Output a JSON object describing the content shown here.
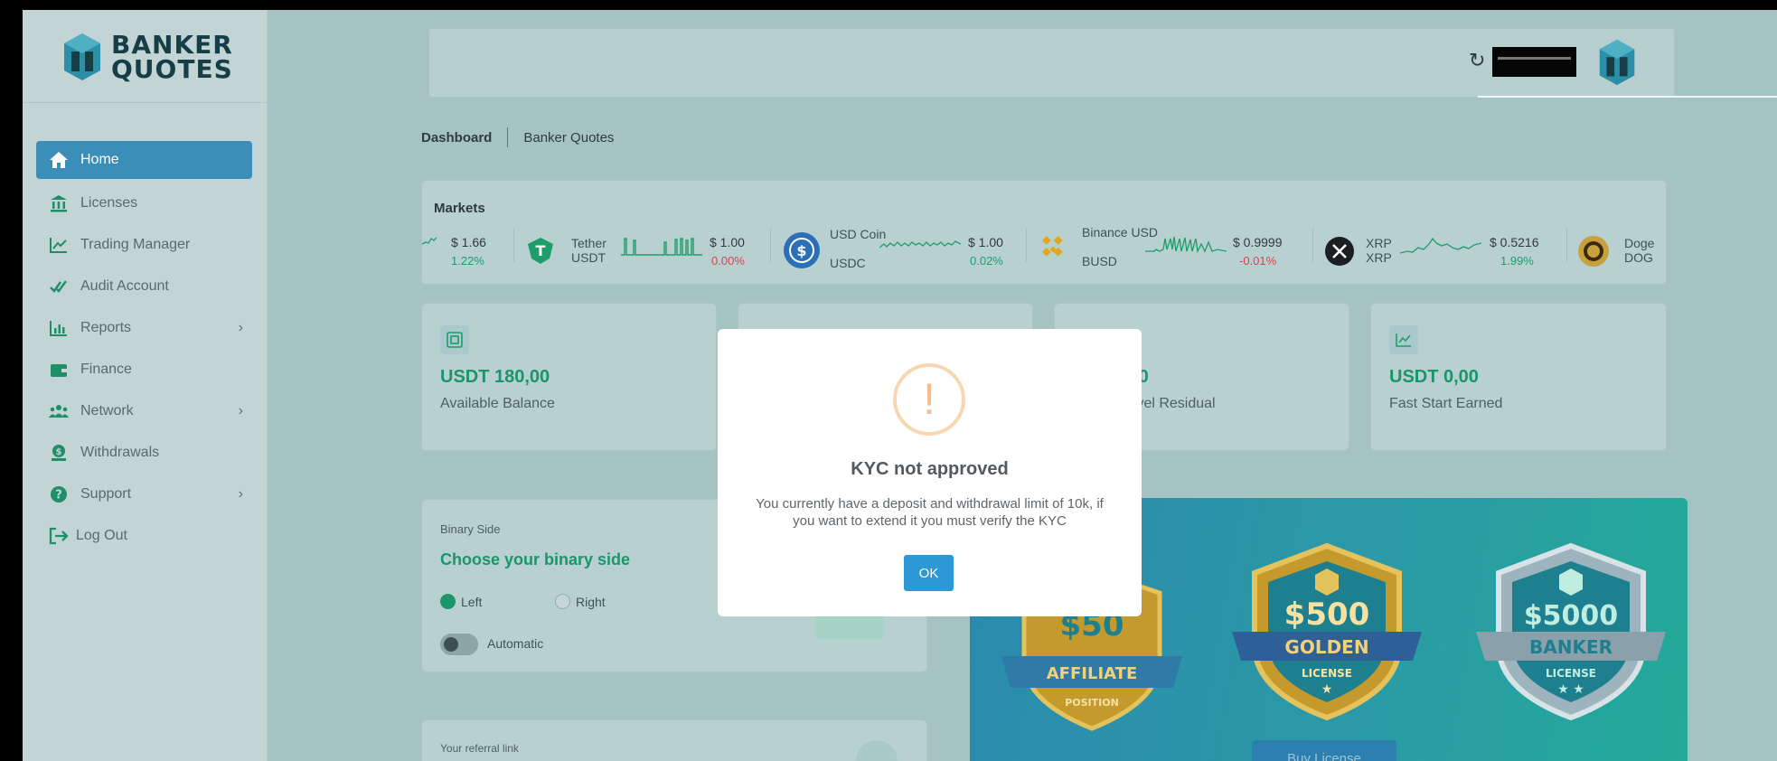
{
  "brand": {
    "line1": "BANKER",
    "line2": "QUOTES"
  },
  "sidebar": {
    "items": [
      {
        "label": "Home",
        "icon": "home-icon"
      },
      {
        "label": "Licenses",
        "icon": "bank-icon"
      },
      {
        "label": "Trading Manager",
        "icon": "chart-line-icon"
      },
      {
        "label": "Audit Account",
        "icon": "double-check-icon"
      },
      {
        "label": "Reports",
        "icon": "bar-chart-icon"
      },
      {
        "label": "Finance",
        "icon": "wallet-icon"
      },
      {
        "label": "Network",
        "icon": "users-icon"
      },
      {
        "label": "Withdrawals",
        "icon": "withdraw-icon"
      },
      {
        "label": "Support",
        "icon": "question-icon"
      },
      {
        "label": "Log Out",
        "icon": "logout-icon"
      }
    ]
  },
  "breadcrumb": {
    "current": "Dashboard",
    "section": "Banker Quotes"
  },
  "markets": {
    "title": "Markets",
    "tickers": [
      {
        "name": "",
        "symbol": "",
        "price": "$ 1.66",
        "change": "1.22%",
        "trend": "up"
      },
      {
        "name": "Tether",
        "symbol": "USDT",
        "price": "$ 1.00",
        "change": "0.00%",
        "trend": "down"
      },
      {
        "name": "USD Coin",
        "symbol": "USDC",
        "price": "$ 1.00",
        "change": "0.02%",
        "trend": "up"
      },
      {
        "name": "Binance USD",
        "symbol": "BUSD",
        "price": "$ 0.9999",
        "change": "-0.01%",
        "trend": "down"
      },
      {
        "name": "XRP",
        "symbol": "XRP",
        "price": "$ 0.5216",
        "change": "1.99%",
        "trend": "up"
      },
      {
        "name": "Doge",
        "symbol": "DOG"
      }
    ]
  },
  "stats": [
    {
      "value": "USDT 180,00",
      "label": "Available Balance"
    },
    {
      "value": ",00",
      "label": "level Residual"
    },
    {
      "value": "USDT 0,00",
      "label": "Fast Start Earned"
    }
  ],
  "binary": {
    "section": "Binary Side",
    "title": "Choose your binary side",
    "left": "Left",
    "right": "Right",
    "automatic": "Automatic"
  },
  "promo": {
    "badges": [
      {
        "amount": "$50",
        "ribbon": "AFFILIATE",
        "sub": "POSITION"
      },
      {
        "amount": "$500",
        "ribbon": "GOLDEN",
        "sub": "LICENSE"
      },
      {
        "amount": "$5000",
        "ribbon": "BANKER",
        "sub": "LICENSE"
      }
    ],
    "button": "Buy License"
  },
  "referral": {
    "label": "Your referral link"
  },
  "modal": {
    "title": "KYC not approved",
    "message": "You currently have a deposit and withdrawal limit of 10k, if you want to extend it you must verify the KYC",
    "ok": "OK"
  },
  "colors": {
    "accent": "#3b8eb8",
    "positive": "#19966b",
    "negative": "#d14750",
    "warning": "#f6bb87",
    "ok_button": "#2c99d6"
  }
}
